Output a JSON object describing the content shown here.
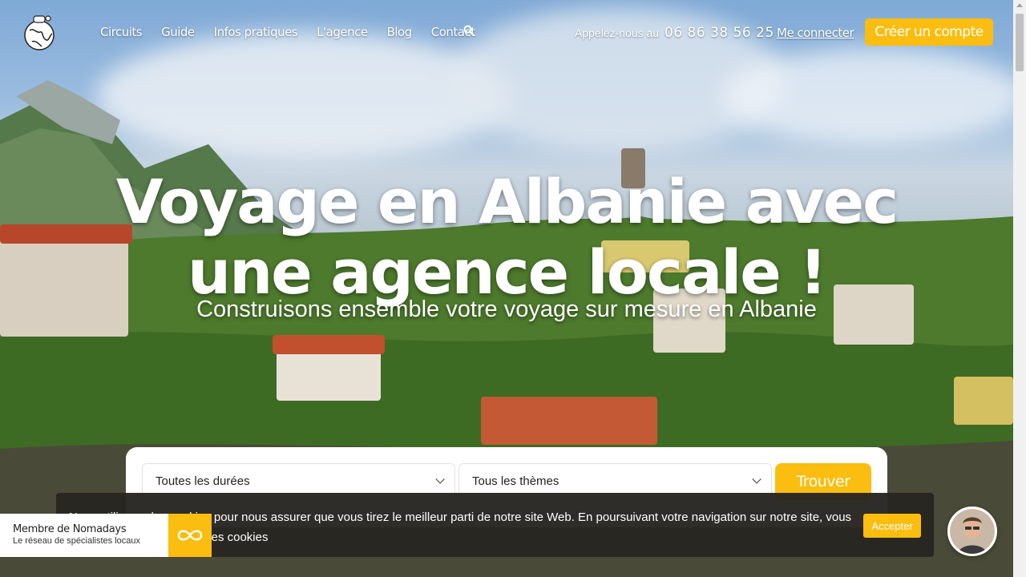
{
  "header": {
    "nav": [
      "Circuits",
      "Guide",
      "Infos pratiques",
      "L'agence",
      "Blog",
      "Contact"
    ],
    "phone_label": "Appelez-nous au",
    "phone_number": "06 86 38 56 25",
    "login": "Me connecter",
    "create_account": "Créer un compte"
  },
  "hero": {
    "title": "Voyage en Albanie avec une agence locale !",
    "subtitle": "Construisons ensemble votre voyage sur mesure en Albanie"
  },
  "search": {
    "duration_selected": "Toutes les durées",
    "theme_selected": "Tous les thèmes",
    "submit": "Trouver"
  },
  "cookie": {
    "text": "Nous utilisons des cookies pour nous assurer que vous tirez le meilleur parti de notre site Web. En poursuivant votre navigation sur notre site, vous acceptez notre utilisation des cookies",
    "accept": "Accepter"
  },
  "badge": {
    "title": "Membre de Nomadays",
    "subtitle": "Le réseau de spécialistes locaux"
  },
  "colors": {
    "accent": "#fbbd0f",
    "banner": "#282622"
  },
  "icons": {
    "logo": "globe-logo-icon",
    "search": "search-icon",
    "chevron": "chevron-down-icon",
    "nomadays": "infinity-icon",
    "chat": "chat-avatar"
  }
}
